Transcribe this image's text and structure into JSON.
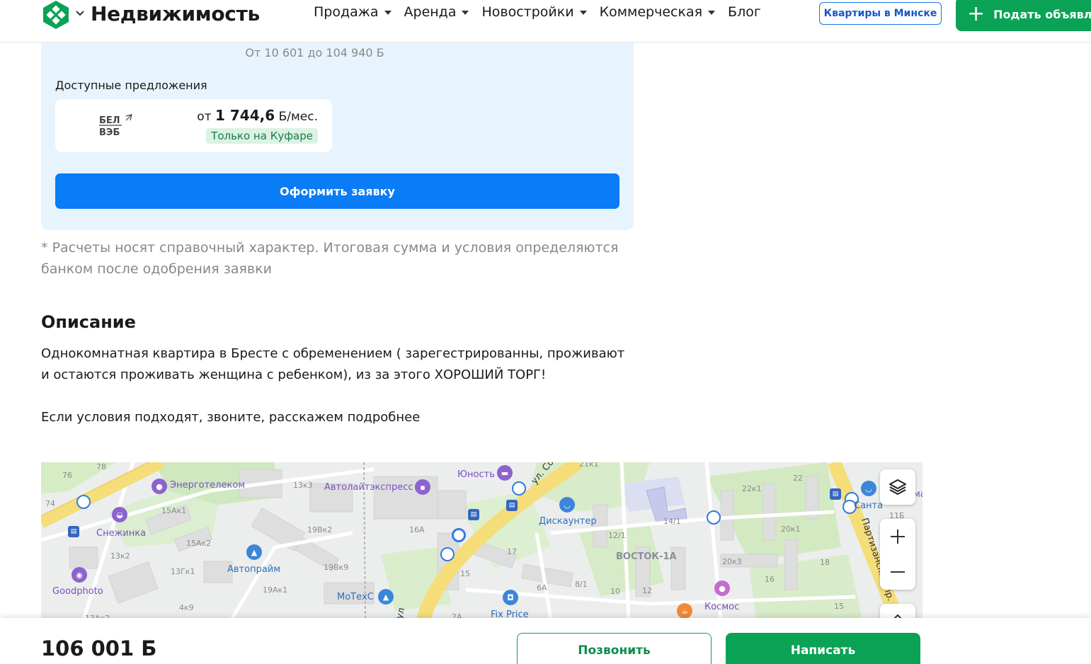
{
  "header": {
    "brand": "Недвижимость",
    "nav": [
      {
        "label": "Продажа",
        "dropdown": true
      },
      {
        "label": "Аренда",
        "dropdown": true
      },
      {
        "label": "Новостройки",
        "dropdown": true
      },
      {
        "label": "Коммерческая",
        "dropdown": true
      },
      {
        "label": "Блог",
        "dropdown": false
      }
    ],
    "city_button": "Квартиры в Минске",
    "post_button": "Подать объявление",
    "icons": {
      "logo": "kufar-logo-icon",
      "menu": "chevron-down-icon",
      "post": "plus-icon"
    }
  },
  "loan": {
    "range": "От 10 601 до 104 940 Б",
    "offers_title": "Доступные предложения",
    "offer": {
      "bank_logo_line1": "БЕЛ",
      "bank_logo_line2": "ВЭБ",
      "price_prefix": "от",
      "price_value": "1 744,6",
      "price_suffix": "Б/мес.",
      "badge": "Только на Куфаре"
    },
    "apply_button": "Оформить заявку"
  },
  "disclaimer": "* Расчеты носят справочный характер. Итоговая сумма и условия определяются банком после одобрения заявки",
  "description": {
    "title": "Описание",
    "paragraphs": [
      "Однокомнатная квартира в Бресте с обременением ( зарегестрированны, проживают и остаются проживать женщина с ребенком), из за этого ХОРОШИЙ ТОРГ!",
      "Если условия подходят, звоните, расскажем подробнее"
    ]
  },
  "map": {
    "poi_labels": [
      {
        "text": "Энерготелеком",
        "kind": "purple"
      },
      {
        "text": "Снежинка",
        "kind": "purple"
      },
      {
        "text": "Goodphoto",
        "kind": "purple"
      },
      {
        "text": "Автолайтэкспресс",
        "kind": "purple"
      },
      {
        "text": "Автопрайм",
        "kind": "blue"
      },
      {
        "text": "МоТехС",
        "kind": "blue"
      },
      {
        "text": "Юность",
        "kind": "purple"
      },
      {
        "text": "Дискаунтер",
        "kind": "blue"
      },
      {
        "text": "Fix Price",
        "kind": "blue"
      },
      {
        "text": "ВОСТОК-1А",
        "kind": "gray"
      },
      {
        "text": "Космос",
        "kind": "purple"
      },
      {
        "text": "Санта",
        "kind": "blue"
      },
      {
        "text": "Партизанский пр.",
        "kind": "road"
      },
      {
        "text": "ул. Со",
        "kind": "road"
      },
      {
        "text": "ул",
        "kind": "road"
      },
      {
        "text": "ма",
        "kind": "purple"
      }
    ],
    "house_numbers": [
      "78",
      "76",
      "74",
      "15Ак1",
      "15Ак2",
      "13к2",
      "13Гк1",
      "4к9",
      "13Ак2",
      "13к3",
      "19Вк2",
      "19Вк9",
      "19Ак1",
      "16А",
      "17",
      "15",
      "6А",
      "8/1",
      "10",
      "12",
      "12/1",
      "14/1",
      "21к1",
      "22к1",
      "22",
      "20к1",
      "20к3",
      "18",
      "16",
      "15",
      "11Б",
      "2А"
    ],
    "controls": {
      "layers": "layers-icon",
      "zoom_in": "plus-icon",
      "zoom_out": "minus-icon"
    }
  },
  "bottom_bar": {
    "price": "106 001 Б",
    "call_button": "Позвонить",
    "write_button": "Написать"
  },
  "colors": {
    "green": "#0aa356",
    "blue": "#0a7cf5",
    "panel": "#e8f4fd"
  }
}
